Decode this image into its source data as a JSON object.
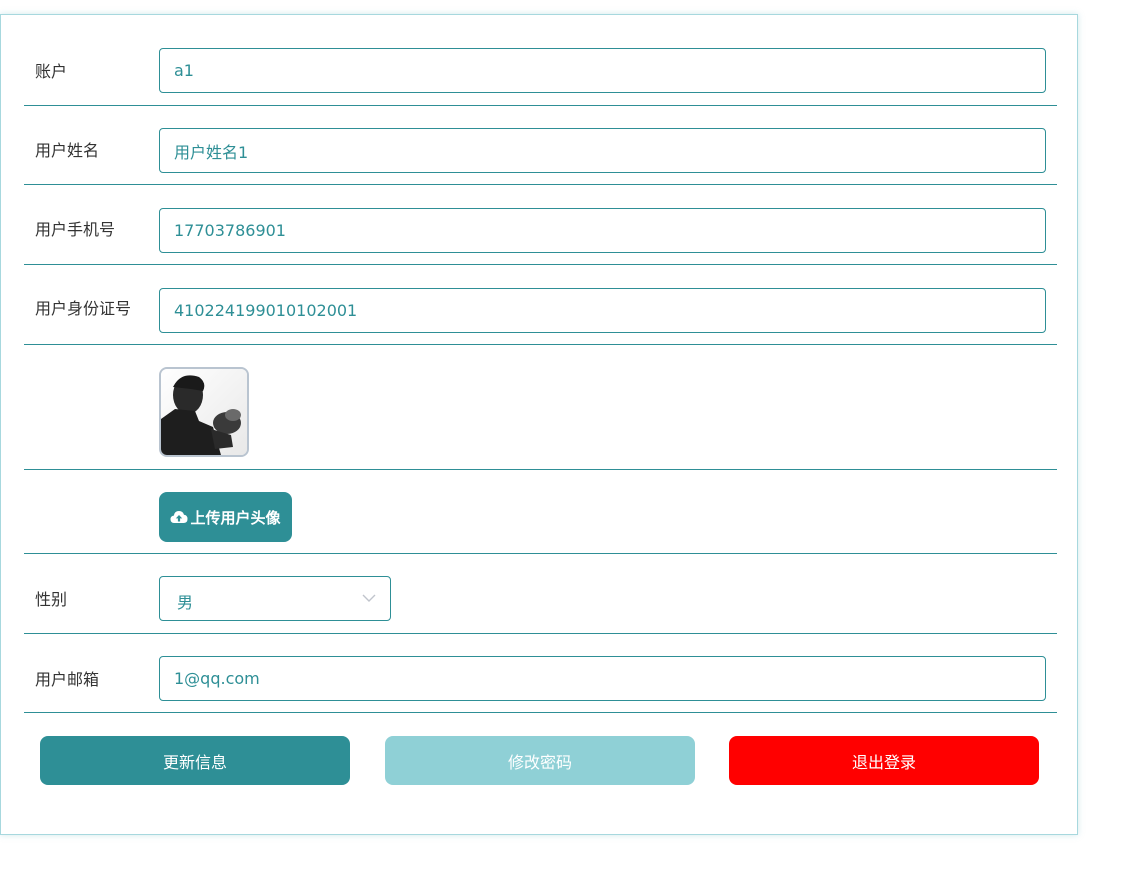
{
  "form": {
    "account": {
      "label": "账户",
      "value": "a1"
    },
    "name": {
      "label": "用户姓名",
      "value": "用户姓名1"
    },
    "phone": {
      "label": "用户手机号",
      "value": "17703786901"
    },
    "id_number": {
      "label": "用户身份证号",
      "value": "410224199010102001"
    },
    "upload": {
      "label": "上传用户头像",
      "icon": "cloud-upload-icon"
    },
    "gender": {
      "label": "性别",
      "selected": "男"
    },
    "email": {
      "label": "用户邮箱",
      "value": "1@qq.com"
    }
  },
  "buttons": {
    "update": {
      "label": "更新信息",
      "color": "#2e8f96"
    },
    "change_password": {
      "label": "修改密码",
      "color": "#8fd0d6"
    },
    "logout": {
      "label": "退出登录",
      "color": "#ff0000"
    }
  },
  "colors": {
    "accent": "#2e8f96",
    "accent_light": "#8fd0d6",
    "danger": "#ff0000",
    "border": "#a7d8de"
  }
}
